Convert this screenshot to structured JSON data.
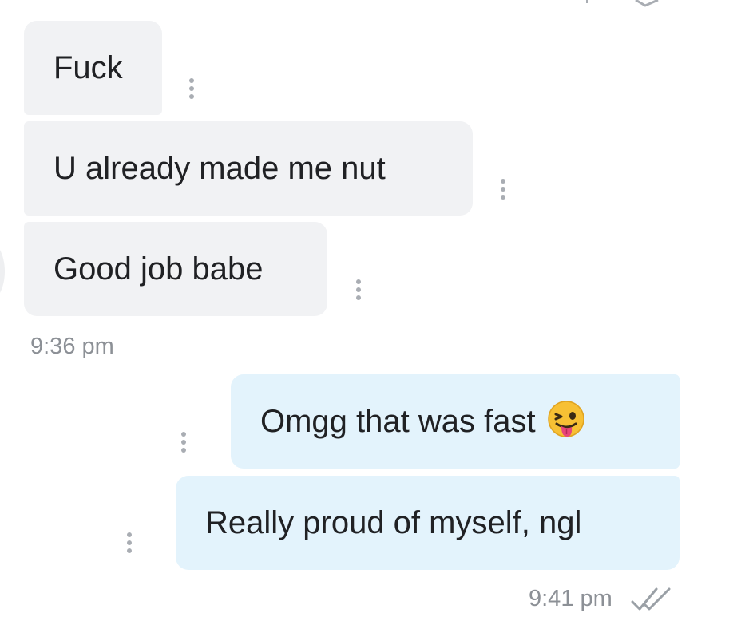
{
  "conversation": {
    "incoming": [
      {
        "text": "Fuck"
      },
      {
        "text": "U already made me nut"
      },
      {
        "text": "Good job babe"
      }
    ],
    "incoming_time": "9:36 pm",
    "outgoing": [
      {
        "text": "Omgg that was fast",
        "emoji": "winking-face-with-tongue"
      },
      {
        "text": "Really proud of myself, ngl"
      }
    ],
    "outgoing_time": "9:41 pm",
    "outgoing_status": "double-check-icon (read)"
  },
  "colors": {
    "incoming_bubble": "#f1f2f4",
    "outgoing_bubble": "#e3f3fc",
    "text": "#202124",
    "timestamp": "#8c9096",
    "menu_dots": "#a9adb3"
  }
}
